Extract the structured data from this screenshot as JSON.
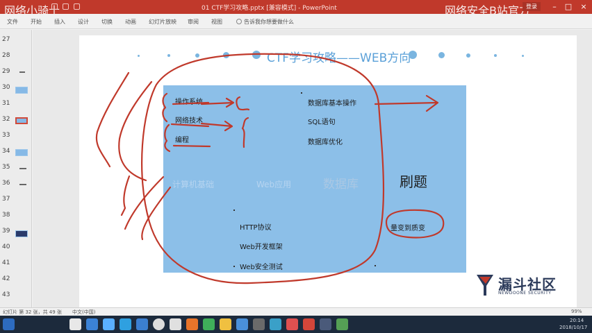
{
  "window": {
    "title": "01 CTF学习攻略.pptx [兼容模式] - PowerPoint",
    "overlay_left": "网络小骑士",
    "overlay_right": "网络安全B站官方",
    "login": "登录"
  },
  "ribbon": {
    "tabs": [
      "文件",
      "开始",
      "插入",
      "设计",
      "切换",
      "动画",
      "幻灯片放映",
      "审阅",
      "视图",
      "告诉我你想要做什么"
    ]
  },
  "slide_panel": {
    "numbers": [
      "27",
      "28",
      "29",
      "30",
      "31",
      "32",
      "33",
      "34",
      "35",
      "36",
      "37",
      "38",
      "39",
      "40",
      "41",
      "42",
      "43"
    ]
  },
  "slide": {
    "title": "CTF学习攻略——WEB方向",
    "foundation": [
      "操作系统",
      "网络技术",
      "编程"
    ],
    "database": [
      "数据库基本操作",
      "SQL语句",
      "数据库优化"
    ],
    "categories": {
      "basic": "计算机基础",
      "web_app": "Web应用",
      "database": "数据库",
      "practice": "刷题"
    },
    "web_items": [
      "HTTP协议",
      "Web开发框架",
      "Web安全测试"
    ],
    "note": "量变到质变"
  },
  "logo": {
    "main": "漏斗社区",
    "sub": "NEWDOONE SECURITY"
  },
  "statusbar": {
    "slide_info": "幻灯片 第 32 张，共 49 张",
    "language": "中文(中国)",
    "zoom": "99%"
  },
  "taskbar": {
    "time": "20:14",
    "date": "2018/10/17"
  },
  "colors": {
    "titlebar": "#c0392b",
    "content_box": "#8cbfe8",
    "title_text": "#5aa0d8",
    "annotation": "#c0392b"
  }
}
